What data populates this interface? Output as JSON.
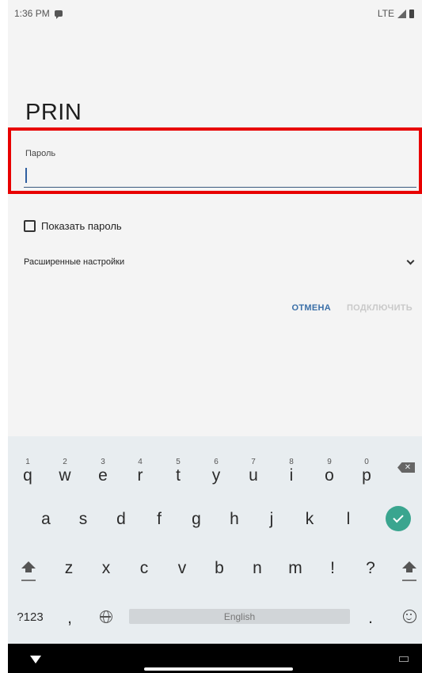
{
  "status_bar": {
    "time": "1:36 PM",
    "network": "LTE"
  },
  "dialog": {
    "title": "PRIN",
    "password_label": "Пароль",
    "password_value": "",
    "show_password_label": "Показать пароль",
    "advanced_settings_label": "Расширенные настройки",
    "cancel_label": "ОТМЕНА",
    "connect_label": "ПОДКЛЮЧИТЬ"
  },
  "keyboard": {
    "row1": [
      {
        "hint": "1",
        "key": "q"
      },
      {
        "hint": "2",
        "key": "w"
      },
      {
        "hint": "3",
        "key": "e"
      },
      {
        "hint": "4",
        "key": "r"
      },
      {
        "hint": "5",
        "key": "t"
      },
      {
        "hint": "6",
        "key": "y"
      },
      {
        "hint": "7",
        "key": "u"
      },
      {
        "hint": "8",
        "key": "i"
      },
      {
        "hint": "9",
        "key": "o"
      },
      {
        "hint": "0",
        "key": "p"
      }
    ],
    "row2": [
      "a",
      "s",
      "d",
      "f",
      "g",
      "h",
      "j",
      "k",
      "l"
    ],
    "row3": [
      "z",
      "x",
      "c",
      "v",
      "b",
      "n",
      "m",
      "!",
      "?"
    ],
    "symbols_label": "?123",
    "comma": ",",
    "space_label": "English",
    "period": ".",
    "accent_color": "#3aa58f"
  }
}
